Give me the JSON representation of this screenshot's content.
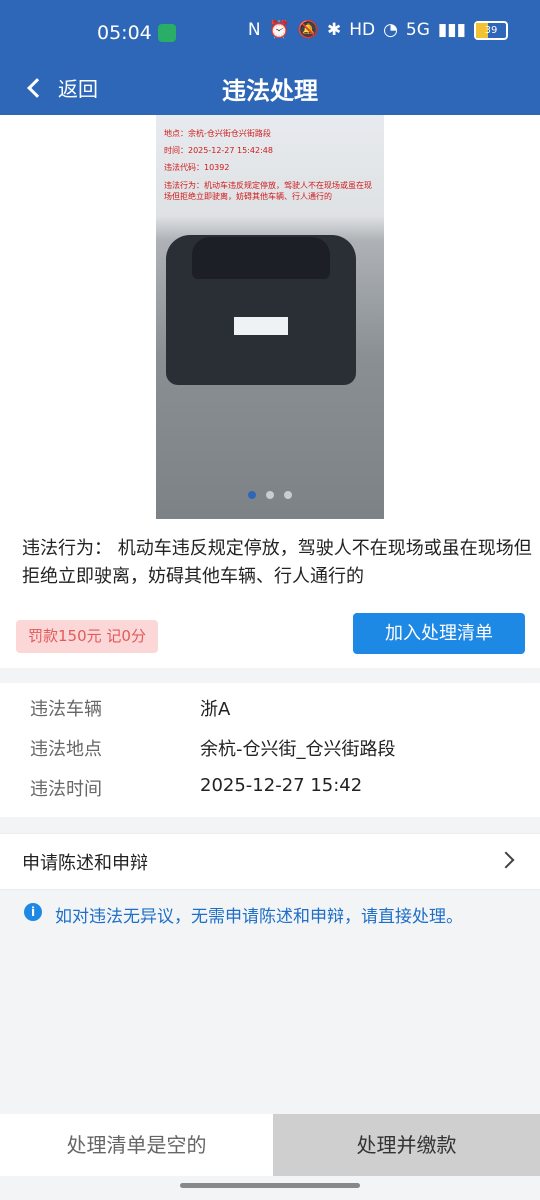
{
  "status": {
    "time": "05:04",
    "network": "5G",
    "battery": "39"
  },
  "nav": {
    "back_label": "返回",
    "title": "违法处理"
  },
  "photo": {
    "location": "地点：余杭-仓兴街仓兴街路段",
    "time": "时间：2025-12-27 15:42:48",
    "code": "违法代码：10392",
    "behavior": "违法行为：机动车违反规定停放，驾驶人不在现场或虽在现场但拒绝立即驶离，妨碍其他车辆、行人通行的",
    "slide_count": 3,
    "active_slide": 1
  },
  "violation": {
    "label": "违法行为：",
    "text": "机动车违反规定停放，驾驶人不在现场或虽在现场但拒绝立即驶离，妨碍其他车辆、行人通行的"
  },
  "fine": {
    "badge": "罚款150元 记0分",
    "add_button": "加入处理清单"
  },
  "details": [
    {
      "label": "违法车辆",
      "value": "浙A"
    },
    {
      "label": "违法地点",
      "value": "余杭-仓兴街_仓兴街路段"
    },
    {
      "label": "违法时间",
      "value": "2025-12-27 15:42"
    }
  ],
  "appeal": {
    "label": "申请陈述和申辩"
  },
  "notice": {
    "text": "如对违法无异议，无需申请陈述和申辩，请直接处理。"
  },
  "bottom": {
    "cart_label": "处理清单是空的",
    "pay_label": "处理并缴款"
  }
}
